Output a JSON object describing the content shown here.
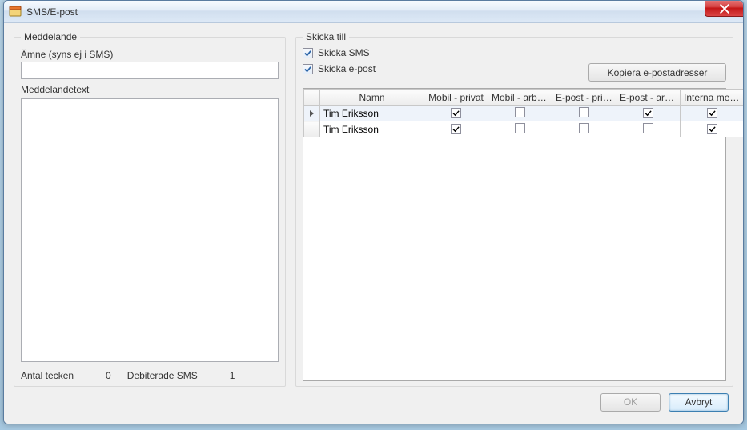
{
  "window": {
    "title": "SMS/E-post"
  },
  "left": {
    "group_title": "Meddelande",
    "subject_label": "Ämne (syns ej i SMS)",
    "subject_value": "",
    "msgtext_label": "Meddelandetext",
    "char_label": "Antal tecken",
    "char_value": "0",
    "sms_label": "Debiterade SMS",
    "sms_value": "1"
  },
  "right": {
    "group_title": "Skicka till",
    "send_sms_label": "Skicka SMS",
    "send_sms_checked": true,
    "send_email_label": "Skicka e-post",
    "send_email_checked": true,
    "copy_button": "Kopiera e-postadresser",
    "grid": {
      "columns": [
        "Namn",
        "Mobil - privat",
        "Mobil - arbete",
        "E-post - privat",
        "E-post - arbete",
        "Interna medd..."
      ],
      "rows": [
        {
          "selected": true,
          "name": "Tim Eriksson",
          "mobil_privat": true,
          "mobil_arbete": false,
          "epost_privat": false,
          "epost_arbete": true,
          "interna": true
        },
        {
          "selected": false,
          "name": "Tim Eriksson",
          "mobil_privat": true,
          "mobil_arbete": false,
          "epost_privat": false,
          "epost_arbete": false,
          "interna": true
        }
      ]
    }
  },
  "buttons": {
    "ok": "OK",
    "cancel": "Avbryt"
  }
}
